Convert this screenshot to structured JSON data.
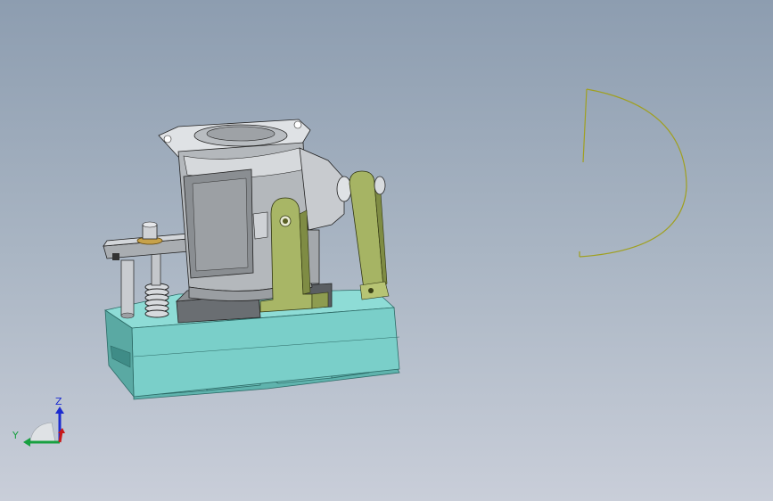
{
  "viewport": {
    "model": "assembly-model",
    "sketch": "sketch-arc"
  },
  "triad": {
    "z_label": "Z",
    "y_label": "Y"
  },
  "colors": {
    "base": "#79c9c3",
    "housing": "#bfc3c7",
    "bracket": "#a6b464",
    "sketch": "#a0a020",
    "axis_z": "#1c2bd0",
    "axis_y": "#18a040",
    "axis_x": "#c81818"
  }
}
